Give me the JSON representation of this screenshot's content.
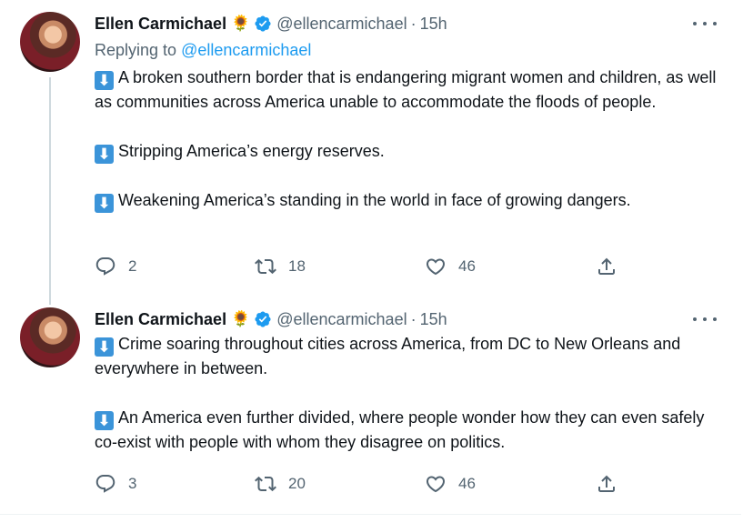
{
  "tweets": [
    {
      "author_name": "Ellen Carmichael",
      "author_emoji": "🌻",
      "handle": "@ellencarmichael",
      "separator": "·",
      "time": "15h",
      "replying_label": "Replying to ",
      "replying_to": "@ellencarmichael",
      "paragraphs": [
        "A broken southern border that is endangering migrant women and children, as well as communities across America unable to accommodate the floods of people.",
        "Stripping America’s energy reserves.",
        "Weakening America’s standing in the world in face of growing dangers."
      ],
      "stats": {
        "replies": "2",
        "retweets": "18",
        "likes": "46"
      }
    },
    {
      "author_name": "Ellen Carmichael",
      "author_emoji": "🌻",
      "handle": "@ellencarmichael",
      "separator": "·",
      "time": "15h",
      "paragraphs": [
        "Crime soaring throughout cities across America, from DC to New Orleans and everywhere in between.",
        "An America even further divided, where people wonder how they can even safely co-exist with people with whom they disagree on politics."
      ],
      "stats": {
        "replies": "3",
        "retweets": "20",
        "likes": "46"
      }
    }
  ],
  "bullet_glyph": "⬇",
  "colors": {
    "accent": "#1d9bf0",
    "text": "#0f1419",
    "muted": "#536471",
    "bullet": "#3b94d9"
  }
}
